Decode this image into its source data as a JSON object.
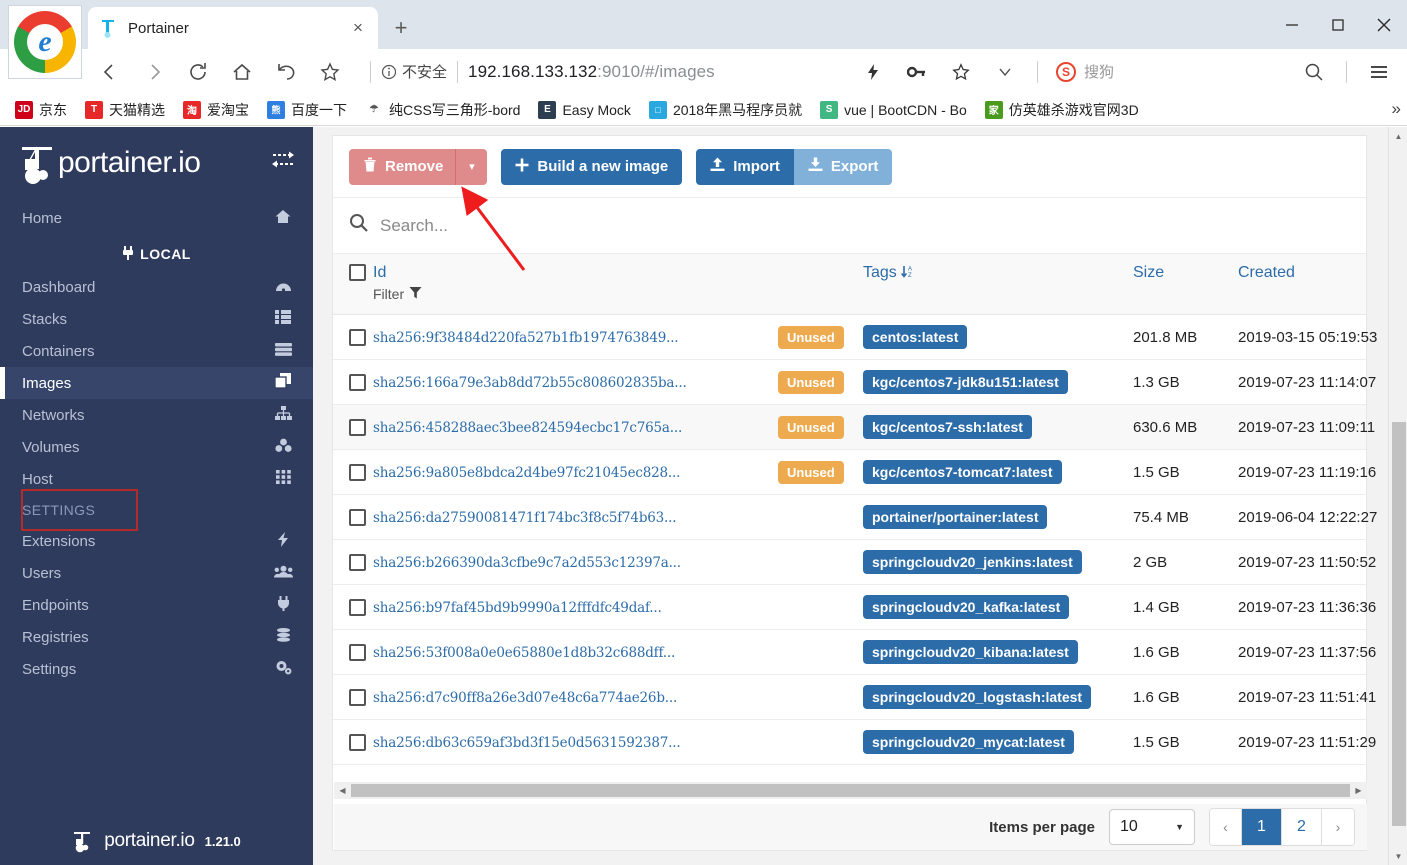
{
  "browser": {
    "tab_title": "Portainer",
    "tab_close": "×",
    "new_tab": "+",
    "minimize": "─",
    "maximize": "□",
    "close": "✕",
    "back": "‹",
    "forward": "›",
    "reload": "⟳",
    "home": "⌂",
    "history": "↺",
    "bookmark_star": "☆",
    "security_label": "不安全",
    "url_host": "192.168.133.132",
    "url_rest": ":9010/#/images",
    "sogou_label": "搜狗",
    "search_icon": "search-icon",
    "menu_icon": "menu-icon",
    "overflow": "»"
  },
  "bookmarks": [
    {
      "label": "京东",
      "icon_text": "JD",
      "icon_color": "#d0021b"
    },
    {
      "label": "天猫精选",
      "icon_text": "T",
      "icon_color": "#e62828"
    },
    {
      "label": "爱淘宝",
      "icon_text": "淘",
      "icon_color": "#e62828"
    },
    {
      "label": "百度一下",
      "icon_text": "熊",
      "icon_color": "#2e7fe0"
    },
    {
      "label": "纯CSS写三角形-bord",
      "icon_text": "☂",
      "icon_color": "#ffffff"
    },
    {
      "label": "Easy Mock",
      "icon_text": "E",
      "icon_color": "#2c3e50"
    },
    {
      "label": "2018年黑马程序员就",
      "icon_text": "□",
      "icon_color": "#29a8e0"
    },
    {
      "label": "vue | BootCDN - Bo",
      "icon_text": "S",
      "icon_color": "#41b883"
    },
    {
      "label": "仿英雄杀游戏官网3D",
      "icon_text": "家",
      "icon_color": "#4a9a1e"
    }
  ],
  "sidebar": {
    "brand": "portainer.io",
    "toggle_icon": "collapse-sidebar-icon",
    "home_label": "Home",
    "home_icon": "home-icon",
    "local_label": "LOCAL",
    "local_icon": "plug-icon",
    "items": [
      {
        "label": "Dashboard",
        "icon": "dashboard-icon",
        "glyph": "◔",
        "active": false
      },
      {
        "label": "Stacks",
        "icon": "stacks-icon",
        "glyph": "☰",
        "active": false
      },
      {
        "label": "Containers",
        "icon": "containers-icon",
        "glyph": "⌸",
        "active": false
      },
      {
        "label": "Images",
        "icon": "images-icon",
        "glyph": "❐",
        "active": true
      },
      {
        "label": "Networks",
        "icon": "networks-icon",
        "glyph": "⛓",
        "active": false
      },
      {
        "label": "Volumes",
        "icon": "volumes-icon",
        "glyph": "☸",
        "active": false
      },
      {
        "label": "Host",
        "icon": "host-icon",
        "glyph": "☷",
        "active": false
      }
    ],
    "settings_section": "SETTINGS",
    "settings_items": [
      {
        "label": "Extensions",
        "icon": "bolt-icon",
        "glyph": "⚡"
      },
      {
        "label": "Users",
        "icon": "users-icon",
        "glyph": "👥"
      },
      {
        "label": "Endpoints",
        "icon": "plug-icon",
        "glyph": "⚡"
      },
      {
        "label": "Registries",
        "icon": "database-icon",
        "glyph": "☲"
      },
      {
        "label": "Settings",
        "icon": "gears-icon",
        "glyph": "⚙"
      }
    ],
    "footer_brand": "portainer.io",
    "footer_version": "1.21.0"
  },
  "toolbar": {
    "remove_label": "Remove",
    "remove_icon": "trash-icon",
    "remove_caret": "▾",
    "build_label": "Build a new image",
    "build_icon": "plus-icon",
    "import_label": "Import",
    "import_icon": "upload-icon",
    "export_label": "Export",
    "export_icon": "download-icon"
  },
  "search": {
    "placeholder": "Search...",
    "value": "",
    "icon": "search-icon"
  },
  "table": {
    "columns": {
      "id": "Id",
      "filter": "Filter",
      "tags": "Tags",
      "tags_sort": "↓ᴬᶻ",
      "size": "Size",
      "created": "Created"
    },
    "rows": [
      {
        "id": "sha256:9f38484d220fa527b1fb1974763849...",
        "state": "Unused",
        "tag": "centos:latest",
        "size": "201.8 MB",
        "created": "2019-03-15 05:19:53"
      },
      {
        "id": "sha256:166a79e3ab8dd72b55c808602835ba...",
        "state": "Unused",
        "tag": "kgc/centos7-jdk8u151:latest",
        "size": "1.3 GB",
        "created": "2019-07-23 11:14:07"
      },
      {
        "id": "sha256:458288aec3bee824594ecbc17c765a...",
        "state": "Unused",
        "tag": "kgc/centos7-ssh:latest",
        "size": "630.6 MB",
        "created": "2019-07-23 11:09:11"
      },
      {
        "id": "sha256:9a805e8bdca2d4be97fc21045ec828...",
        "state": "Unused",
        "tag": "kgc/centos7-tomcat7:latest",
        "size": "1.5 GB",
        "created": "2019-07-23 11:19:16"
      },
      {
        "id": "sha256:da27590081471f174bc3f8c5f74b63...",
        "state": "",
        "tag": "portainer/portainer:latest",
        "size": "75.4 MB",
        "created": "2019-06-04 12:22:27"
      },
      {
        "id": "sha256:b266390da3cfbe9c7a2d553c12397a...",
        "state": "",
        "tag": "springcloudv20_jenkins:latest",
        "size": "2 GB",
        "created": "2019-07-23 11:50:52"
      },
      {
        "id": "sha256:b97faf45bd9b9990a12fffdfc49daf...",
        "state": "",
        "tag": "springcloudv20_kafka:latest",
        "size": "1.4 GB",
        "created": "2019-07-23 11:36:36"
      },
      {
        "id": "sha256:53f008a0e0e65880e1d8b32c688dff...",
        "state": "",
        "tag": "springcloudv20_kibana:latest",
        "size": "1.6 GB",
        "created": "2019-07-23 11:37:56"
      },
      {
        "id": "sha256:d7c90ff8a26e3d07e48c6a774ae26b...",
        "state": "",
        "tag": "springcloudv20_logstash:latest",
        "size": "1.6 GB",
        "created": "2019-07-23 11:51:41"
      },
      {
        "id": "sha256:db63c659af3bd3f15e0d5631592387...",
        "state": "",
        "tag": "springcloudv20_mycat:latest",
        "size": "1.5 GB",
        "created": "2019-07-23 11:51:29"
      }
    ]
  },
  "pagination": {
    "items_per_page_label": "Items per page",
    "items_per_page_value": "10",
    "prev": "‹",
    "next": "›",
    "pages": [
      "1",
      "2"
    ],
    "active_page": "1"
  },
  "colors": {
    "sidebar_bg": "#2f3b5c",
    "accent_blue": "#2c6ca9",
    "badge_orange": "#edaa4f",
    "remove_red": "#e08b8b",
    "annotation_red": "#ee1c1c"
  }
}
